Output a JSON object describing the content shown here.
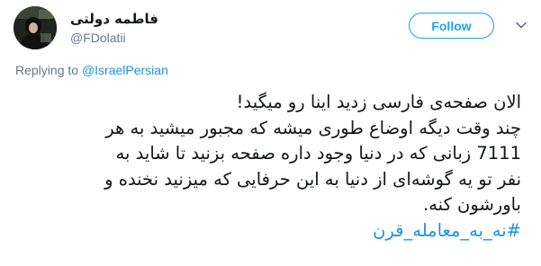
{
  "author": {
    "display_name": "فاطمه دولتی",
    "handle": "@FDolatii"
  },
  "actions": {
    "follow_label": "Follow",
    "caret_icon": "chevron-down-icon"
  },
  "reply_context": {
    "prefix": "Replying to ",
    "mention": "@IsraelPersian"
  },
  "tweet": {
    "lines": [
      "الان صفحه‌ی فارسی زدید اینا رو میگید!",
      "چند وقت دیگه اوضاع طوری میشه که مجبور میشید به هر",
      "7111 زبانی که در دنیا وجود داره صفحه بزنید تا شاید به",
      "نفر تو یه گوشه‌ای از دنیا به این حرفایی که میزنید نخنده و",
      "باورشون کنه."
    ],
    "hashtag": "#نه_به_معامله_قرن"
  },
  "colors": {
    "accent": "#1da1f2",
    "link": "#1b95e0",
    "muted": "#657786",
    "text": "#14171a"
  }
}
